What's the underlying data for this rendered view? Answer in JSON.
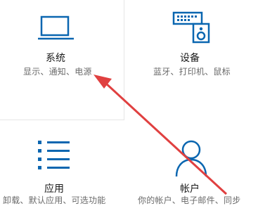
{
  "settings": {
    "accent_color": "#0a66b0",
    "annotation_color": "#e04040",
    "tiles": [
      {
        "title": "系统",
        "subtitle": "显示、通知、电源",
        "icon": "laptop-icon"
      },
      {
        "title": "设备",
        "subtitle": "蓝牙、打印机、鼠标",
        "icon": "devices-icon"
      },
      {
        "title": "应用",
        "subtitle": "卸载、默认应用、可选功能",
        "icon": "apps-list-icon"
      },
      {
        "title": "帐户",
        "subtitle": "你的帐户、电子邮件、同步",
        "icon": "person-icon"
      }
    ]
  }
}
